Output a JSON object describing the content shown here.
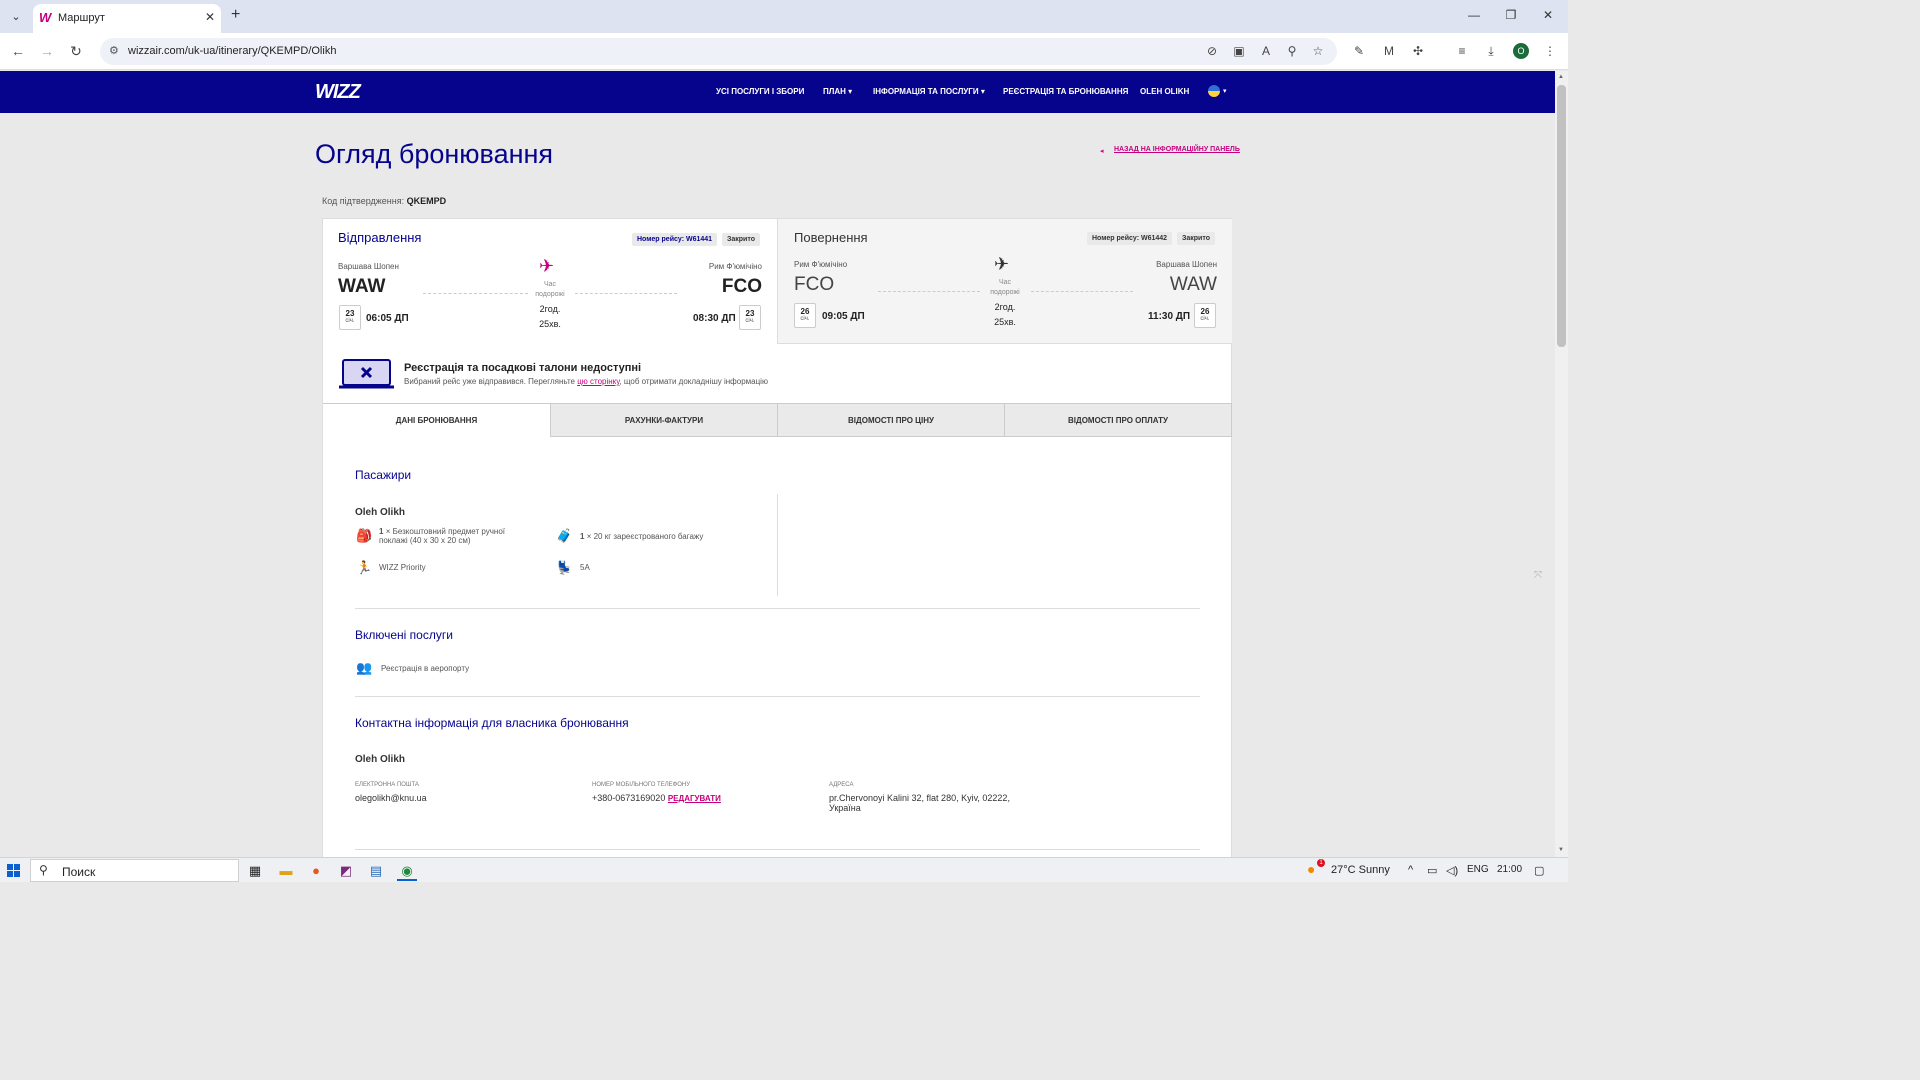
{
  "browser": {
    "tab_title": "Маршрут",
    "url": "wizzair.com/uk-ua/itinerary/QKEMPD/Olikh",
    "profile_initial": "O"
  },
  "header": {
    "logo": "WIZZ",
    "nav": {
      "all_services": "УСІ ПОСЛУГИ І ЗБОРИ",
      "plan": "ПЛАН",
      "info": "ІНФОРМАЦІЯ ТА ПОСЛУГИ",
      "checkin": "РЕЄСТРАЦІЯ ТА БРОНЮВАННЯ",
      "user": "OLEH OLIKH"
    }
  },
  "page": {
    "title": "Огляд бронювання",
    "back_link": "НАЗАД НА ІНФОРМАЦІЙНУ ПАНЕЛЬ",
    "confirmation_label": "Код підтвердження:",
    "confirmation_code": "QKEMPD"
  },
  "outbound": {
    "heading": "Відправлення",
    "flight_no": "Номер рейсу: W61441",
    "status": "Закрито",
    "from_city": "Варшава Шопен",
    "from_code": "WAW",
    "to_city": "Рим Ф'юмічіно",
    "to_code": "FCO",
    "duration_label_1": "Час",
    "duration_label_2": "подорожі",
    "duration_h": "2год.",
    "duration_m": "25хв.",
    "dep_day": "23",
    "dep_month": "січ.",
    "dep_time": "06:05 ДП",
    "arr_day": "23",
    "arr_month": "січ.",
    "arr_time": "08:30 ДП"
  },
  "return": {
    "heading": "Повернення",
    "flight_no": "Номер рейсу: W61442",
    "status": "Закрито",
    "from_city": "Рим Ф'юмічіно",
    "from_code": "FCO",
    "to_city": "Варшава Шопен",
    "to_code": "WAW",
    "duration_label_1": "Час",
    "duration_label_2": "подорожі",
    "duration_h": "2год.",
    "duration_m": "25хв.",
    "dep_day": "26",
    "dep_month": "січ.",
    "dep_time": "09:05 ДП",
    "arr_day": "26",
    "arr_month": "січ.",
    "arr_time": "11:30 ДП"
  },
  "notice": {
    "title": "Реєстрація та посадкові талони недоступні",
    "text_before": "Вибраний рейс уже відправився. Перегляньте ",
    "link": "цю сторінку",
    "text_after": ", щоб отримати докладнішу інформацію"
  },
  "tabs": [
    "ДАНІ БРОНЮВАННЯ",
    "РАХУНКИ-ФАКТУРИ",
    "ВІДОМОСТІ ПРО ЦІНУ",
    "ВІДОМОСТІ ПРО ОПЛАТУ"
  ],
  "passengers": {
    "title": "Пасажири",
    "name": "Oleh Olikh",
    "cabin_bag_count": "1",
    "cabin_bag": "× Безкоштовний предмет ручної",
    "cabin_bag_2": "поклажі (40 x 30 x 20 см)",
    "checked_bag_count": "1",
    "checked_bag": "× 20 кг зареєстрованого багажу",
    "priority": "WIZZ Priority",
    "seat": "5A"
  },
  "included": {
    "title": "Включені послуги",
    "item": "Реєстрація в аеропорту"
  },
  "contact": {
    "title": "Контактна інформація для власника бронювання",
    "name": "Oleh Olikh",
    "email_label": "ЕЛЕКТРОННА ПОШТА",
    "email": "olegolikh@knu.ua",
    "phone_label": "НОМЕР МОБІЛЬНОГО ТЕЛЕФОНУ",
    "phone": "+380-0673169020",
    "edit": "РЕДАГУВАТИ",
    "address_label": "АДРЕСА",
    "address_1": "pr.Chervonoyi Kalini 32, flat 280, Kyiv, 02222,",
    "address_2": "Україна"
  },
  "taskbar": {
    "search_placeholder": "Поиск",
    "weather_badge": "1",
    "weather": "27°C  Sunny",
    "lang": "ENG",
    "time": "21:00"
  },
  "colors": {
    "brand_navy": "#06038d",
    "brand_magenta": "#c6007e"
  }
}
